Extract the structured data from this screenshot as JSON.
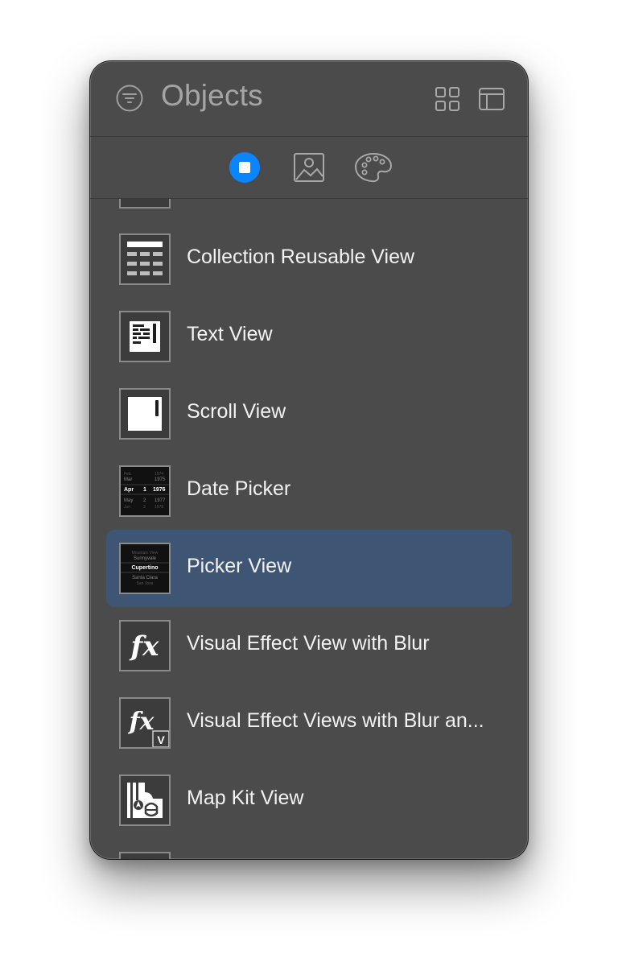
{
  "header": {
    "title": "Objects",
    "filter_icon": "filter-icon",
    "grid_icon": "grid-icon",
    "layout_icon": "layout-icon"
  },
  "tabs": [
    {
      "name": "objects-tab",
      "icon": "stop-circle-icon",
      "selected": true
    },
    {
      "name": "media-tab",
      "icon": "image-icon",
      "selected": false
    },
    {
      "name": "colors-tab",
      "icon": "palette-icon",
      "selected": false
    }
  ],
  "items": [
    {
      "label": "Collection Reusable View",
      "icon": "collection-reusable-view-icon"
    },
    {
      "label": "Text View",
      "icon": "text-view-icon"
    },
    {
      "label": "Scroll View",
      "icon": "scroll-view-icon"
    },
    {
      "label": "Date Picker",
      "icon": "date-picker-icon"
    },
    {
      "label": "Picker View",
      "icon": "picker-view-icon",
      "selected": true
    },
    {
      "label": "Visual Effect View with Blur",
      "icon": "visual-effect-icon"
    },
    {
      "label": "Visual Effect Views with Blur an...",
      "icon": "visual-effect-vibrancy-icon"
    },
    {
      "label": "Map Kit View",
      "icon": "map-kit-view-icon"
    }
  ],
  "thumb_text": {
    "date_picker": {
      "rows": [
        {
          "m": "Feb",
          "y": "1974"
        },
        {
          "m": "Mar",
          "y": "1975"
        },
        {
          "m": "Apr",
          "d": "1",
          "y": "1976"
        },
        {
          "m": "May",
          "d": "2",
          "y": "1977"
        },
        {
          "m": "Jun",
          "d": "3",
          "y": "1978"
        }
      ]
    },
    "picker_view": {
      "rows": [
        "Mountain View",
        "Sunnyvale",
        "Cupertino",
        "Santa Clara",
        "San Jose"
      ]
    },
    "fx": "fx",
    "fx_badge": "V"
  },
  "colors": {
    "accent": "#0a84ff",
    "window": "#4b4b4b",
    "selection": "#3e5573"
  }
}
